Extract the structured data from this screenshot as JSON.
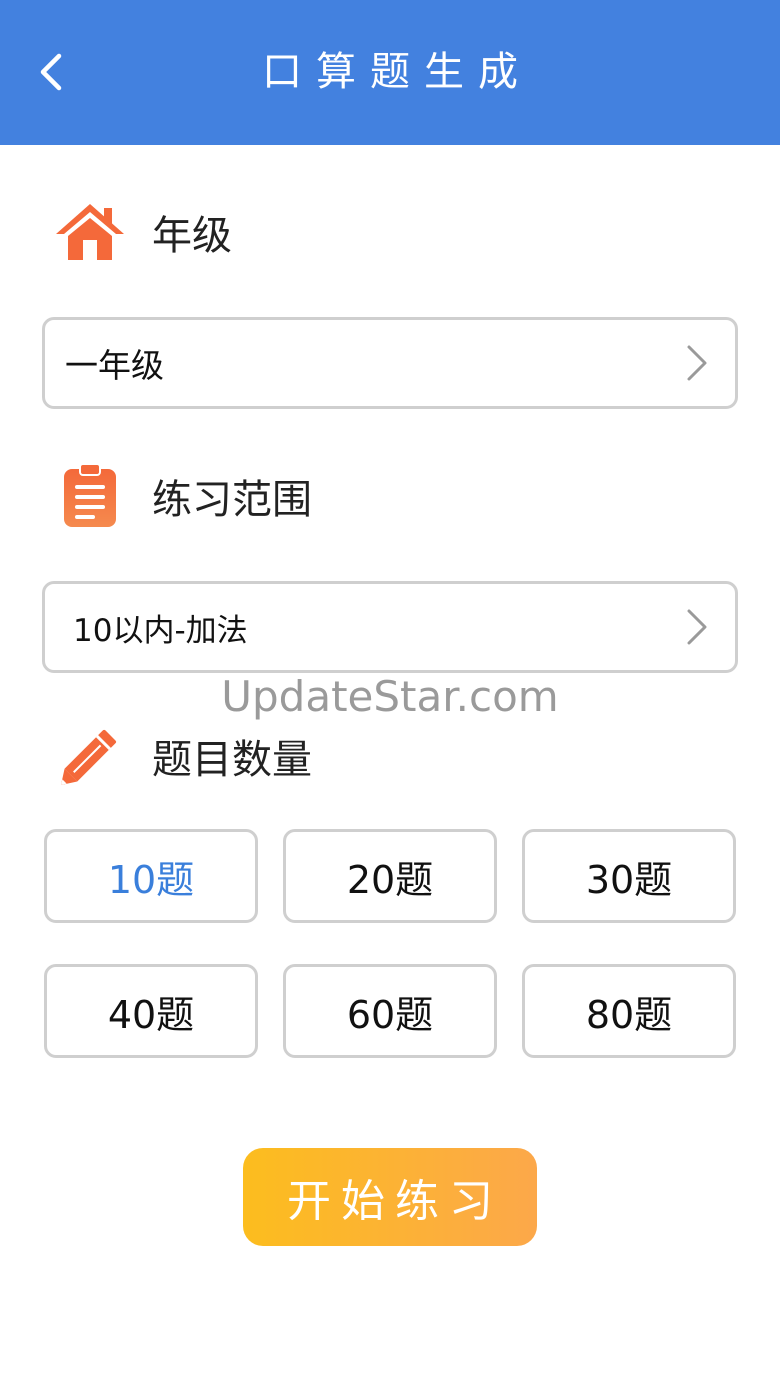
{
  "header": {
    "title": "口算题生成",
    "back_icon": "chevron-left-icon"
  },
  "grade": {
    "label": "年级",
    "icon": "house-icon",
    "value": "一年级"
  },
  "range": {
    "label": "练习范围",
    "icon": "clipboard-icon",
    "value": "10以内-加法"
  },
  "watermark": "UpdateStar.com",
  "quantity": {
    "label": "题目数量",
    "icon": "pencil-icon",
    "options": [
      "10题",
      "20题",
      "30题",
      "40题",
      "60题",
      "80题"
    ],
    "selected": "10题"
  },
  "start_button": "开始练习",
  "colors": {
    "header": "#4381df",
    "accent_orange": "#f4693a",
    "selected_text": "#3a7fdb",
    "button_gradient_start": "#fcbd1e",
    "button_gradient_end": "#fca84a"
  }
}
